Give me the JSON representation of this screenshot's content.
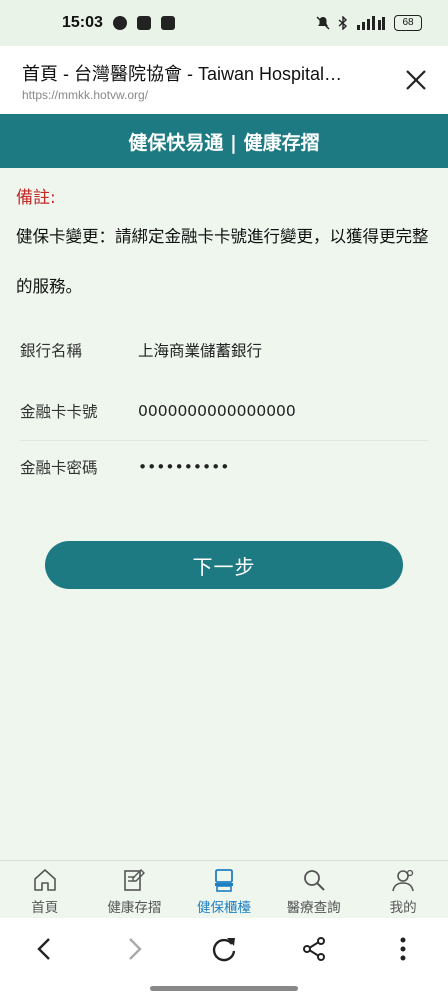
{
  "status_bar": {
    "time": "15:03",
    "battery": "68"
  },
  "browser": {
    "title": "首頁 - 台灣醫院協會 - Taiwan Hospital…",
    "url": "https://mmkk.hotvw.org/"
  },
  "header": {
    "title": "健保快易通 | 健康存摺"
  },
  "note": {
    "title": "備註:",
    "body": "健保卡變更：請綁定金融卡卡號進行變更，以獲得更完整的服務。"
  },
  "form": {
    "bank_label": "銀行名稱",
    "bank_value": "上海商業儲蓄銀行",
    "card_label": "金融卡卡號",
    "card_value": "0000000000000000",
    "password_label": "金融卡密碼",
    "password_value": "••••••••••"
  },
  "next_button": "下一步",
  "bottom_nav": {
    "items": [
      {
        "label": "首頁",
        "icon": "home-icon"
      },
      {
        "label": "健康存摺",
        "icon": "edit-note-icon"
      },
      {
        "label": "健保櫃檯",
        "icon": "counter-icon"
      },
      {
        "label": "醫療查詢",
        "icon": "search-icon"
      },
      {
        "label": "我的",
        "icon": "profile-icon"
      }
    ],
    "active_index": 2,
    "active_color": "#1e7fc2"
  },
  "colors": {
    "primary": "#1d7a82",
    "note_red": "#c62828",
    "background": "#eef6ee"
  }
}
